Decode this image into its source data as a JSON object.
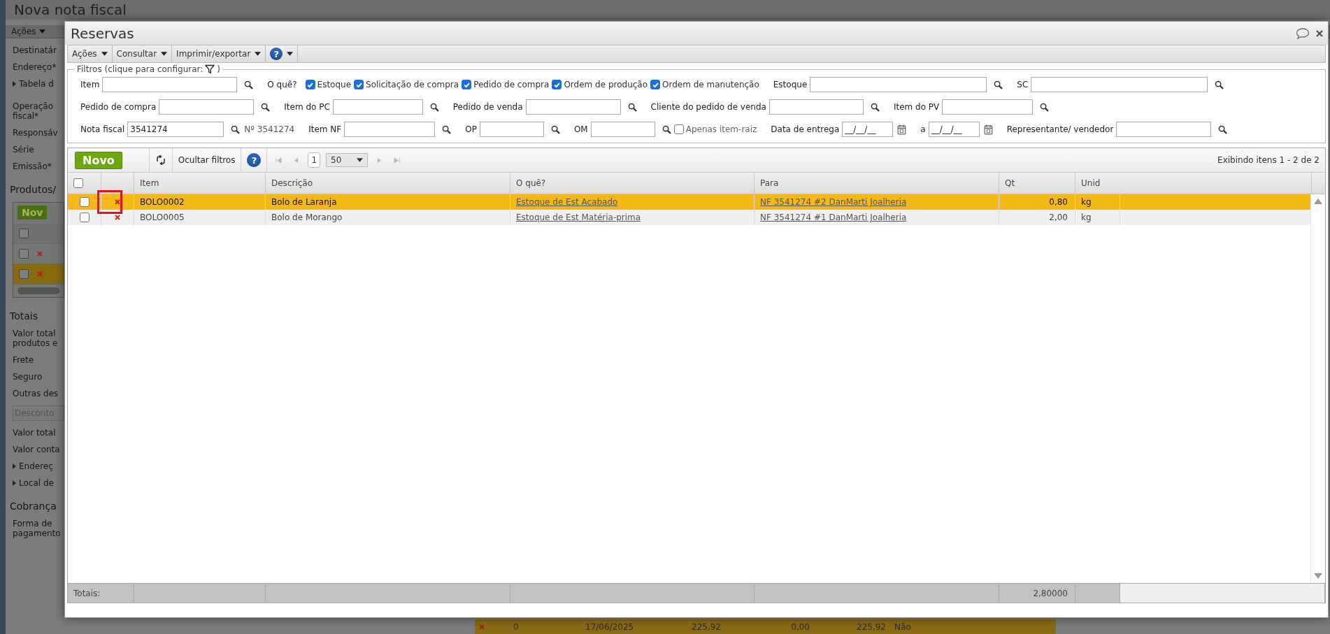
{
  "background_window": {
    "title": "Nova nota fiscal",
    "menu": "Ações",
    "sections": [
      {
        "items": [
          {
            "kind": "label",
            "text": "Destinatár"
          },
          {
            "kind": "label",
            "text": "Endereço*"
          },
          {
            "kind": "expander",
            "text": "Tabela d"
          }
        ]
      },
      {
        "items": [
          {
            "kind": "label",
            "text": "Operação fiscal*"
          },
          {
            "kind": "label",
            "text": "Responsáv"
          },
          {
            "kind": "label",
            "text": "Série"
          },
          {
            "kind": "label",
            "text": "Emissão*"
          }
        ]
      },
      {
        "title": "Produtos/",
        "grid": {
          "new_button": "Nov",
          "select_all": {
            "checked": false
          },
          "rows": [
            {
              "selected": false,
              "checked": false
            },
            {
              "selected": true,
              "checked": false
            }
          ]
        }
      },
      {
        "title": "Totais",
        "items": [
          {
            "kind": "label",
            "text": "Valor total produtos e"
          },
          {
            "kind": "label",
            "text": "Frete"
          },
          {
            "kind": "label",
            "text": "Seguro"
          },
          {
            "kind": "label",
            "text": "Outras des"
          },
          {
            "kind": "input",
            "placeholder": "Desconto"
          },
          {
            "kind": "label",
            "text": "Valor total"
          },
          {
            "kind": "label",
            "text": "Valor conta"
          },
          {
            "kind": "expander",
            "text": "Endereç"
          },
          {
            "kind": "expander",
            "text": "Local de"
          }
        ]
      },
      {
        "title": "Cobrança",
        "items": [
          {
            "kind": "label",
            "text": "Forma de pagamento"
          }
        ]
      }
    ],
    "bottom_row": [
      "0",
      "17/06/2025",
      "225,92",
      "0,00",
      "225,92",
      "Não"
    ]
  },
  "dialog": {
    "title": "Reservas",
    "menu": [
      {
        "kind": "menu",
        "label": "Ações"
      },
      {
        "kind": "menu",
        "label": "Consultar"
      },
      {
        "kind": "menu",
        "label": "Imprimir/exportar"
      },
      {
        "kind": "help",
        "label": "?"
      }
    ],
    "filters": {
      "legend_before": "Filtros (clique para configurar:",
      "legend_after": ")",
      "rows": [
        {
          "fields": [
            {
              "kind": "field",
              "label": "Item"
            },
            {
              "kind": "label",
              "label": "O quê?"
            },
            {
              "kind": "check",
              "label": "Estoque",
              "checked": true
            },
            {
              "kind": "check",
              "label": "Solicitação de compra",
              "checked": true
            },
            {
              "kind": "check",
              "label": "Pedido de compra",
              "checked": true
            },
            {
              "kind": "check",
              "label": "Ordem de produção",
              "checked": true
            },
            {
              "kind": "check",
              "label": "Ordem de manutenção",
              "checked": true
            },
            {
              "kind": "field",
              "label": "Estoque"
            },
            {
              "kind": "field",
              "label": "SC"
            }
          ]
        },
        {
          "fields": [
            {
              "kind": "field",
              "label": "Pedido de compra"
            },
            {
              "kind": "field",
              "label": "Item do PC"
            },
            {
              "kind": "field",
              "label": "Pedido de venda"
            },
            {
              "kind": "field",
              "label": "Cliente do pedido de venda"
            },
            {
              "kind": "field",
              "label": "Item do PV"
            }
          ]
        },
        {
          "fields": [
            {
              "kind": "field",
              "label": "Nota fiscal",
              "value": "3541274"
            },
            {
              "kind": "note",
              "label": "Nº 3541274"
            },
            {
              "kind": "field",
              "label": "Item NF"
            },
            {
              "kind": "field",
              "label": "OP"
            },
            {
              "kind": "field",
              "label": "OM"
            },
            {
              "kind": "check",
              "label": "Apenas item-raiz",
              "checked": false
            },
            {
              "kind": "date",
              "label": "Data de entrega",
              "value": "__/__/__"
            },
            {
              "kind": "date",
              "label": "a",
              "value": "__/__/__"
            },
            {
              "kind": "field",
              "label": "Representante/ vendedor"
            }
          ]
        }
      ]
    },
    "toolbar": {
      "new_button": "Novo",
      "toggle_filters": "Ocultar filtros",
      "help": "?",
      "page": "1",
      "page_size": "50",
      "status": "Exibindo itens 1 - 2 de 2"
    },
    "table": {
      "select_all": {
        "checked": false
      },
      "columns": [
        "Item",
        "Descrição",
        "O quê?",
        "Para",
        "Qt",
        "Unid"
      ],
      "rows": [
        {
          "selected": true,
          "checked": false,
          "flagged": true,
          "item": "BOLO0002",
          "descricao": "Bolo de Laranja",
          "oque": "Estoque de Est Acabado",
          "para": "NF 3541274 #2 DanMarti Joalheria",
          "qt": "0,80",
          "unid": "kg"
        },
        {
          "selected": false,
          "checked": false,
          "flagged": false,
          "item": "BOLO0005",
          "descricao": "Bolo de Morango",
          "oque": "Estoque de Est Matéria-prima",
          "para": "NF 3541274 #1 DanMarti Joalheria",
          "qt": "2,00",
          "unid": "kg"
        }
      ],
      "totals": {
        "label": "Totais:",
        "qt": "2,80000"
      }
    }
  }
}
